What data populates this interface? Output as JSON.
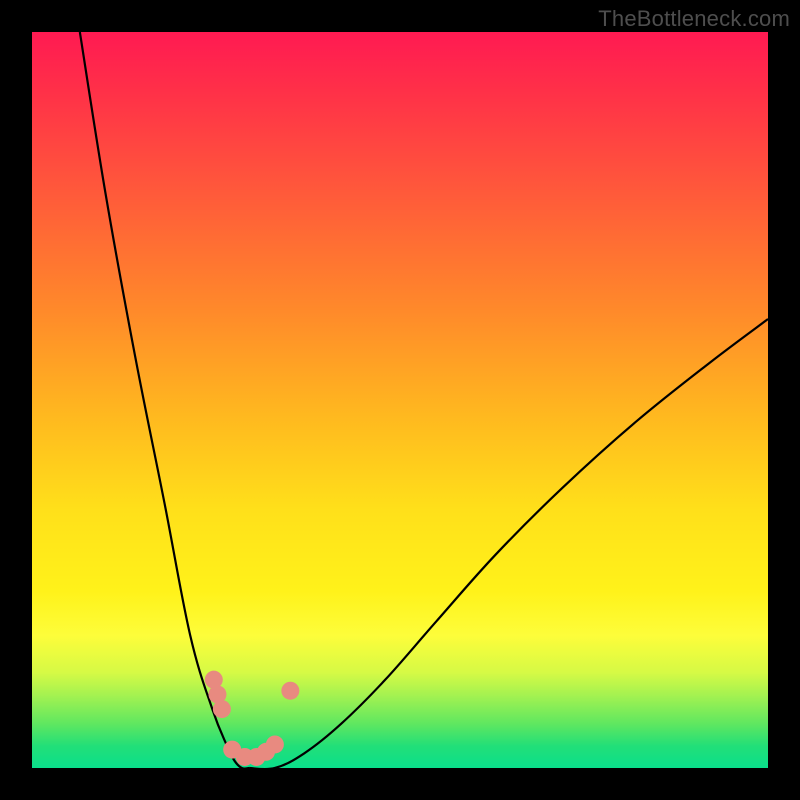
{
  "watermark": "TheBottleneck.com",
  "colors": {
    "background_frame": "#000000",
    "gradient_top": "#ff1a52",
    "gradient_bottom": "#0adf8b",
    "curve_stroke": "#000000",
    "dot_fill": "#e88a80"
  },
  "chart_data": {
    "type": "line",
    "title": "",
    "xlabel": "",
    "ylabel": "",
    "y_axis_note": "background color encodes bottleneck severity (green≈0 to red≈100)",
    "x_range_fraction": [
      0,
      1
    ],
    "y_range_percent": [
      0,
      100
    ],
    "series": [
      {
        "name": "left-branch",
        "note": "x is fraction of plot width, y is percent (0=bottom,100=top)",
        "x": [
          0.065,
          0.1,
          0.14,
          0.18,
          0.215,
          0.245,
          0.265,
          0.275,
          0.285,
          0.295
        ],
        "y": [
          100,
          78,
          56,
          36,
          18,
          8,
          3,
          1,
          0,
          0
        ]
      },
      {
        "name": "right-branch",
        "x": [
          0.295,
          0.33,
          0.37,
          0.42,
          0.48,
          0.55,
          0.63,
          0.72,
          0.82,
          0.92,
          1.0
        ],
        "y": [
          0,
          0,
          2,
          6,
          12,
          20,
          29,
          38,
          47,
          55,
          61
        ]
      }
    ],
    "markers": {
      "name": "highlighted-points",
      "x": [
        0.247,
        0.252,
        0.258,
        0.272,
        0.289,
        0.305,
        0.318,
        0.33,
        0.351
      ],
      "y": [
        12,
        10,
        8,
        2.5,
        1.5,
        1.5,
        2.2,
        3.2,
        10.5
      ]
    }
  }
}
